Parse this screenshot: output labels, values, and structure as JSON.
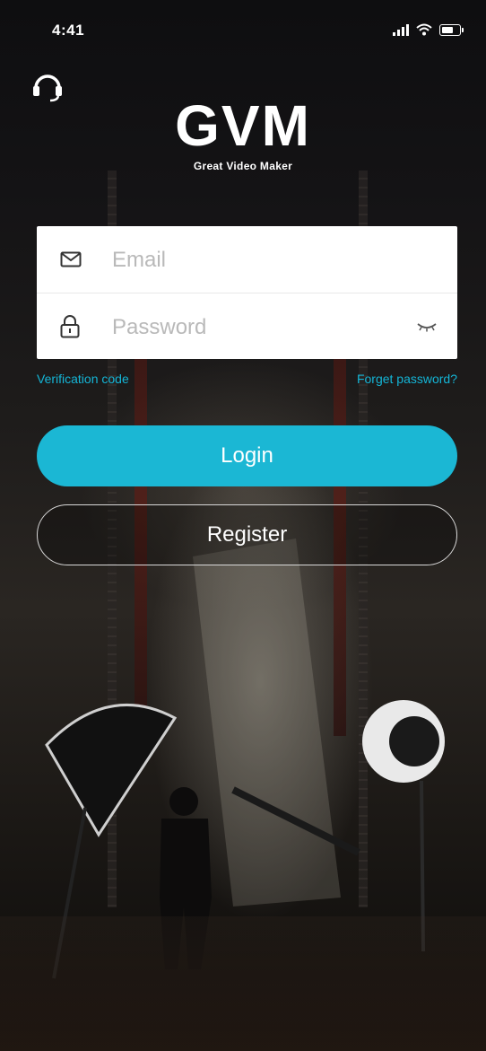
{
  "status_bar": {
    "time": "4:41"
  },
  "icons": {
    "support": "headset-icon",
    "email": "envelope-icon",
    "password": "lock-icon",
    "toggle": "eye-closed-icon"
  },
  "brand": {
    "title": "GVM",
    "subtitle": "Great Video Maker"
  },
  "form": {
    "email": {
      "value": "",
      "placeholder": "Email"
    },
    "password": {
      "value": "",
      "placeholder": "Password"
    }
  },
  "links": {
    "verification": "Verification code",
    "forgot": "Forget password?"
  },
  "buttons": {
    "login": "Login",
    "register": "Register"
  },
  "colors": {
    "accent": "#1bb7d4",
    "link": "#14b5d6",
    "background": "#0b0b0d"
  }
}
